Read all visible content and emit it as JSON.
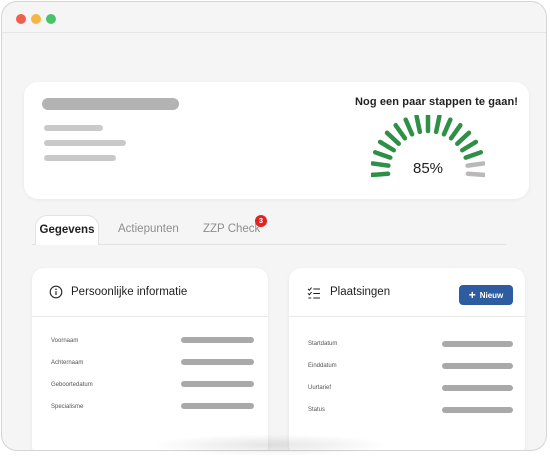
{
  "hero": {
    "progress_text": "Nog  een paar stappen te gaan!",
    "progress_value": 0.85,
    "progress_label": "85%",
    "gauge_segments_total": 17,
    "gauge_segments_filled": 15,
    "colors": {
      "filled": "#2f8f46",
      "empty": "#b9b9b9"
    }
  },
  "tabs": [
    {
      "label": "Gegevens",
      "active": true
    },
    {
      "label": "Actiepunten",
      "active": false
    },
    {
      "label": "ZZP Check",
      "active": false,
      "badge": "3"
    }
  ],
  "personal": {
    "title": "Persoonlijke informatie",
    "icon": "info-circle-icon",
    "fields": [
      "Voornaam",
      "Achternaam",
      "Geboortedatum",
      "Specialisme"
    ]
  },
  "placements": {
    "title": "Plaatsingen",
    "icon": "checklist-icon",
    "new_button_label": "Nieuw",
    "fields": [
      "Startdatum",
      "Einddatum",
      "Uurtarief",
      "Status"
    ]
  },
  "colors": {
    "accent": "#2d5da0",
    "badge": "#e02424"
  }
}
